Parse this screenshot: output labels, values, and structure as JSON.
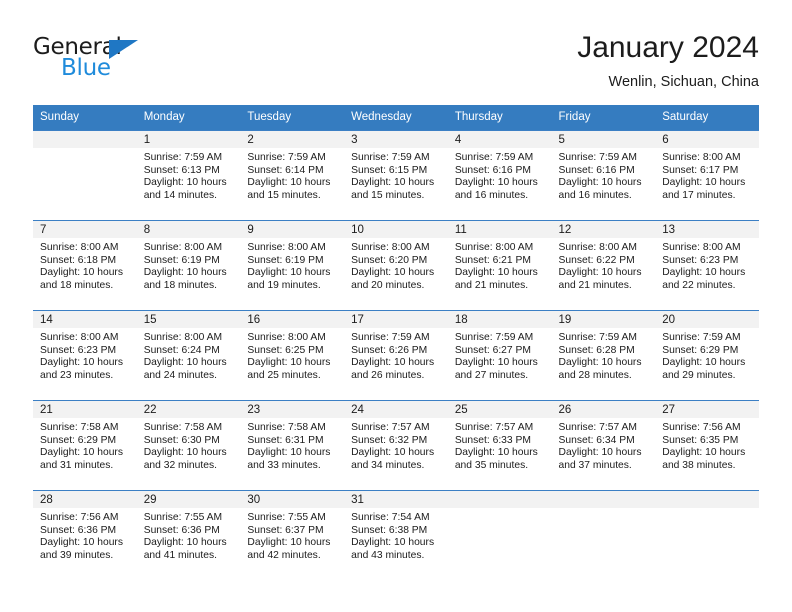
{
  "brand": {
    "word1": "General",
    "word2": "Blue",
    "triangle_color": "#1f77c4",
    "word2_color": "#1f8bdb"
  },
  "header": {
    "title": "January 2024",
    "location": "Wenlin, Sichuan, China"
  },
  "theme": {
    "header_row_bg": "#357cc0",
    "header_row_text": "#ffffff",
    "day_number_bg": "#f2f2f2",
    "cell_border": "#3b7fc4"
  },
  "weekdays": [
    "Sunday",
    "Monday",
    "Tuesday",
    "Wednesday",
    "Thursday",
    "Friday",
    "Saturday"
  ],
  "weeks": [
    [
      {
        "day": "",
        "sunrise": "",
        "sunset": "",
        "daylight_line1": "",
        "daylight_line2": "",
        "empty": true
      },
      {
        "day": "1",
        "sunrise": "Sunrise: 7:59 AM",
        "sunset": "Sunset: 6:13 PM",
        "daylight_line1": "Daylight: 10 hours",
        "daylight_line2": "and 14 minutes."
      },
      {
        "day": "2",
        "sunrise": "Sunrise: 7:59 AM",
        "sunset": "Sunset: 6:14 PM",
        "daylight_line1": "Daylight: 10 hours",
        "daylight_line2": "and 15 minutes."
      },
      {
        "day": "3",
        "sunrise": "Sunrise: 7:59 AM",
        "sunset": "Sunset: 6:15 PM",
        "daylight_line1": "Daylight: 10 hours",
        "daylight_line2": "and 15 minutes."
      },
      {
        "day": "4",
        "sunrise": "Sunrise: 7:59 AM",
        "sunset": "Sunset: 6:16 PM",
        "daylight_line1": "Daylight: 10 hours",
        "daylight_line2": "and 16 minutes."
      },
      {
        "day": "5",
        "sunrise": "Sunrise: 7:59 AM",
        "sunset": "Sunset: 6:16 PM",
        "daylight_line1": "Daylight: 10 hours",
        "daylight_line2": "and 16 minutes."
      },
      {
        "day": "6",
        "sunrise": "Sunrise: 8:00 AM",
        "sunset": "Sunset: 6:17 PM",
        "daylight_line1": "Daylight: 10 hours",
        "daylight_line2": "and 17 minutes."
      }
    ],
    [
      {
        "day": "7",
        "sunrise": "Sunrise: 8:00 AM",
        "sunset": "Sunset: 6:18 PM",
        "daylight_line1": "Daylight: 10 hours",
        "daylight_line2": "and 18 minutes."
      },
      {
        "day": "8",
        "sunrise": "Sunrise: 8:00 AM",
        "sunset": "Sunset: 6:19 PM",
        "daylight_line1": "Daylight: 10 hours",
        "daylight_line2": "and 18 minutes."
      },
      {
        "day": "9",
        "sunrise": "Sunrise: 8:00 AM",
        "sunset": "Sunset: 6:19 PM",
        "daylight_line1": "Daylight: 10 hours",
        "daylight_line2": "and 19 minutes."
      },
      {
        "day": "10",
        "sunrise": "Sunrise: 8:00 AM",
        "sunset": "Sunset: 6:20 PM",
        "daylight_line1": "Daylight: 10 hours",
        "daylight_line2": "and 20 minutes."
      },
      {
        "day": "11",
        "sunrise": "Sunrise: 8:00 AM",
        "sunset": "Sunset: 6:21 PM",
        "daylight_line1": "Daylight: 10 hours",
        "daylight_line2": "and 21 minutes."
      },
      {
        "day": "12",
        "sunrise": "Sunrise: 8:00 AM",
        "sunset": "Sunset: 6:22 PM",
        "daylight_line1": "Daylight: 10 hours",
        "daylight_line2": "and 21 minutes."
      },
      {
        "day": "13",
        "sunrise": "Sunrise: 8:00 AM",
        "sunset": "Sunset: 6:23 PM",
        "daylight_line1": "Daylight: 10 hours",
        "daylight_line2": "and 22 minutes."
      }
    ],
    [
      {
        "day": "14",
        "sunrise": "Sunrise: 8:00 AM",
        "sunset": "Sunset: 6:23 PM",
        "daylight_line1": "Daylight: 10 hours",
        "daylight_line2": "and 23 minutes."
      },
      {
        "day": "15",
        "sunrise": "Sunrise: 8:00 AM",
        "sunset": "Sunset: 6:24 PM",
        "daylight_line1": "Daylight: 10 hours",
        "daylight_line2": "and 24 minutes."
      },
      {
        "day": "16",
        "sunrise": "Sunrise: 8:00 AM",
        "sunset": "Sunset: 6:25 PM",
        "daylight_line1": "Daylight: 10 hours",
        "daylight_line2": "and 25 minutes."
      },
      {
        "day": "17",
        "sunrise": "Sunrise: 7:59 AM",
        "sunset": "Sunset: 6:26 PM",
        "daylight_line1": "Daylight: 10 hours",
        "daylight_line2": "and 26 minutes."
      },
      {
        "day": "18",
        "sunrise": "Sunrise: 7:59 AM",
        "sunset": "Sunset: 6:27 PM",
        "daylight_line1": "Daylight: 10 hours",
        "daylight_line2": "and 27 minutes."
      },
      {
        "day": "19",
        "sunrise": "Sunrise: 7:59 AM",
        "sunset": "Sunset: 6:28 PM",
        "daylight_line1": "Daylight: 10 hours",
        "daylight_line2": "and 28 minutes."
      },
      {
        "day": "20",
        "sunrise": "Sunrise: 7:59 AM",
        "sunset": "Sunset: 6:29 PM",
        "daylight_line1": "Daylight: 10 hours",
        "daylight_line2": "and 29 minutes."
      }
    ],
    [
      {
        "day": "21",
        "sunrise": "Sunrise: 7:58 AM",
        "sunset": "Sunset: 6:29 PM",
        "daylight_line1": "Daylight: 10 hours",
        "daylight_line2": "and 31 minutes."
      },
      {
        "day": "22",
        "sunrise": "Sunrise: 7:58 AM",
        "sunset": "Sunset: 6:30 PM",
        "daylight_line1": "Daylight: 10 hours",
        "daylight_line2": "and 32 minutes."
      },
      {
        "day": "23",
        "sunrise": "Sunrise: 7:58 AM",
        "sunset": "Sunset: 6:31 PM",
        "daylight_line1": "Daylight: 10 hours",
        "daylight_line2": "and 33 minutes."
      },
      {
        "day": "24",
        "sunrise": "Sunrise: 7:57 AM",
        "sunset": "Sunset: 6:32 PM",
        "daylight_line1": "Daylight: 10 hours",
        "daylight_line2": "and 34 minutes."
      },
      {
        "day": "25",
        "sunrise": "Sunrise: 7:57 AM",
        "sunset": "Sunset: 6:33 PM",
        "daylight_line1": "Daylight: 10 hours",
        "daylight_line2": "and 35 minutes."
      },
      {
        "day": "26",
        "sunrise": "Sunrise: 7:57 AM",
        "sunset": "Sunset: 6:34 PM",
        "daylight_line1": "Daylight: 10 hours",
        "daylight_line2": "and 37 minutes."
      },
      {
        "day": "27",
        "sunrise": "Sunrise: 7:56 AM",
        "sunset": "Sunset: 6:35 PM",
        "daylight_line1": "Daylight: 10 hours",
        "daylight_line2": "and 38 minutes."
      }
    ],
    [
      {
        "day": "28",
        "sunrise": "Sunrise: 7:56 AM",
        "sunset": "Sunset: 6:36 PM",
        "daylight_line1": "Daylight: 10 hours",
        "daylight_line2": "and 39 minutes."
      },
      {
        "day": "29",
        "sunrise": "Sunrise: 7:55 AM",
        "sunset": "Sunset: 6:36 PM",
        "daylight_line1": "Daylight: 10 hours",
        "daylight_line2": "and 41 minutes."
      },
      {
        "day": "30",
        "sunrise": "Sunrise: 7:55 AM",
        "sunset": "Sunset: 6:37 PM",
        "daylight_line1": "Daylight: 10 hours",
        "daylight_line2": "and 42 minutes."
      },
      {
        "day": "31",
        "sunrise": "Sunrise: 7:54 AM",
        "sunset": "Sunset: 6:38 PM",
        "daylight_line1": "Daylight: 10 hours",
        "daylight_line2": "and 43 minutes."
      },
      {
        "day": "",
        "sunrise": "",
        "sunset": "",
        "daylight_line1": "",
        "daylight_line2": "",
        "empty": true
      },
      {
        "day": "",
        "sunrise": "",
        "sunset": "",
        "daylight_line1": "",
        "daylight_line2": "",
        "empty": true
      },
      {
        "day": "",
        "sunrise": "",
        "sunset": "",
        "daylight_line1": "",
        "daylight_line2": "",
        "empty": true
      }
    ]
  ]
}
